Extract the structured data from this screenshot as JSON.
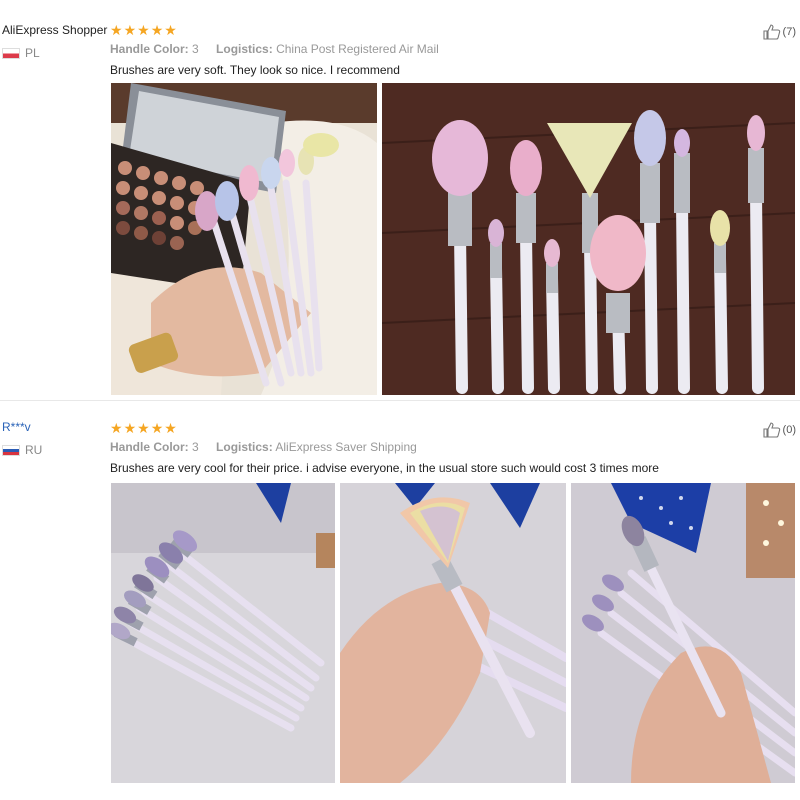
{
  "reviews": [
    {
      "user": "AliExpress Shopper",
      "country": "PL",
      "rating": 5,
      "likes": "(7)",
      "handle_color_label": "Handle Color:",
      "handle_color": "3",
      "logistics_label": "Logistics:",
      "logistics": "China Post Registered Air Mail",
      "comment": "Brushes are very soft. They look so nice. I recommend"
    },
    {
      "user": "R***v",
      "country": "RU",
      "rating": 5,
      "likes": "(0)",
      "handle_color_label": "Handle Color:",
      "handle_color": "3",
      "logistics_label": "Logistics:",
      "logistics": "AliExpress Saver Shipping",
      "comment": "Brushes are very cool for their price. i advise everyone, in the usual store such would cost 3 times more"
    }
  ],
  "colors": {
    "star": "#f5a623",
    "username_link": "#2a63b8"
  },
  "icons": {
    "rating": "star-icon",
    "helpful": "thumbs-up-icon"
  }
}
